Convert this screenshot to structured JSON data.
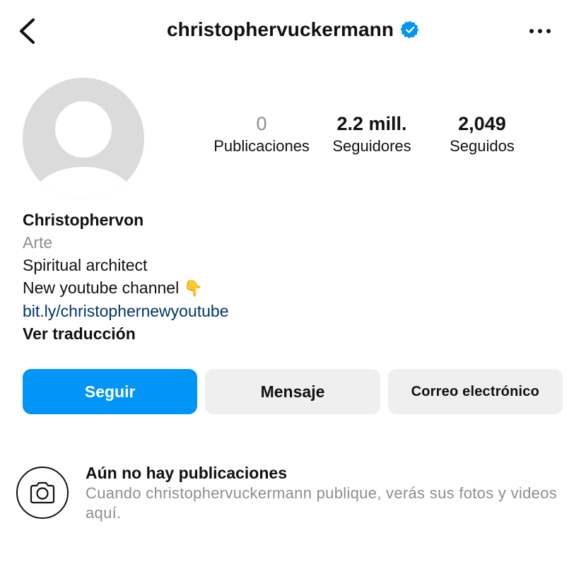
{
  "header": {
    "username": "christophervuckermann",
    "verified": true,
    "back_icon": "chevron-left-icon",
    "more_icon": "more-horizontal-icon"
  },
  "profile": {
    "avatar": "default-avatar-placeholder",
    "stats": {
      "posts_value": "0",
      "posts_label": "Publicaciones",
      "followers_value": "2.2 mill.",
      "followers_label": "Seguidores",
      "following_value": "2,049",
      "following_label": "Seguidos"
    },
    "bio": {
      "name": "Christophervon",
      "category": "Arte",
      "line1": "Spiritual architect",
      "line2": "New youtube channel",
      "line2_emoji": "👇",
      "link": "bit.ly/christophernewyoutube",
      "translate": "Ver traducción"
    }
  },
  "actions": {
    "follow": "Seguir",
    "message": "Mensaje",
    "email": "Correo electrónico"
  },
  "empty_state": {
    "icon": "camera-icon",
    "title": "Aún no hay publicaciones",
    "subtitle": "Cuando christophervuckermann publique, verás sus fotos y videos aquí."
  },
  "colors": {
    "primary": "#0095f6",
    "verified": "#0095f6",
    "link": "#00376b",
    "muted": "#8e8e8e",
    "button_secondary": "#efefef"
  }
}
